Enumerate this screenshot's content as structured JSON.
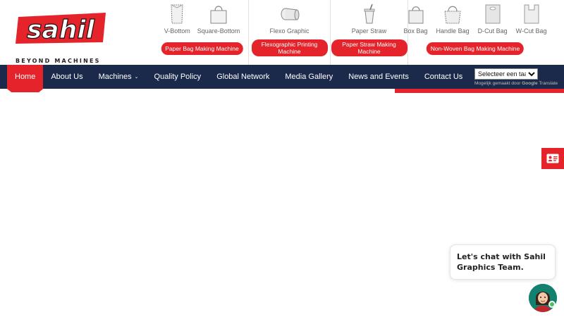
{
  "brand": {
    "name": "Sahil",
    "tagline": "BEYOND MACHINES",
    "colors": {
      "red": "#e4242a",
      "navy": "#1b2a4a",
      "dark": "#222222"
    }
  },
  "header": {
    "groups": [
      {
        "items": [
          {
            "label": "V-Bottom",
            "icon": "v-bottom-bag-icon"
          },
          {
            "label": "Square-Bottom",
            "icon": "square-bottom-bag-icon"
          }
        ],
        "button": "Paper Bag Making Machine"
      },
      {
        "items": [
          {
            "label": "Flexo Graphic",
            "icon": "flexo-roll-icon"
          }
        ],
        "button": "Flexographic Printing Machine"
      },
      {
        "items": [
          {
            "label": "Paper Straw",
            "icon": "paper-straw-icon"
          }
        ],
        "button": "Paper Straw Making Machine"
      },
      {
        "items": [
          {
            "label": "Box Bag",
            "icon": "box-bag-icon"
          },
          {
            "label": "Handle Bag",
            "icon": "handle-bag-icon"
          },
          {
            "label": "D-Cut Bag",
            "icon": "d-cut-bag-icon"
          },
          {
            "label": "W-Cut Bag",
            "icon": "w-cut-bag-icon"
          }
        ],
        "button": "Non-Woven Bag Making Machine"
      }
    ]
  },
  "nav": {
    "items": [
      {
        "label": "Home",
        "active": true
      },
      {
        "label": "About Us"
      },
      {
        "label": "Machines",
        "dropdown": true
      },
      {
        "label": "Quality Policy"
      },
      {
        "label": "Global Network"
      },
      {
        "label": "Media Gallery"
      },
      {
        "label": "News and Events"
      },
      {
        "label": "Contact Us"
      }
    ]
  },
  "translate": {
    "select_label": "Selecteer een taal",
    "powered_prefix": "Mogelijk gemaakt door",
    "google": "Google",
    "translate": "Translate"
  },
  "contact_tab": {
    "icon": "contact-card-icon"
  },
  "chat": {
    "message": "Let's chat with Sahil Graphics Team.",
    "avatar_icon": "support-agent-avatar-icon"
  }
}
